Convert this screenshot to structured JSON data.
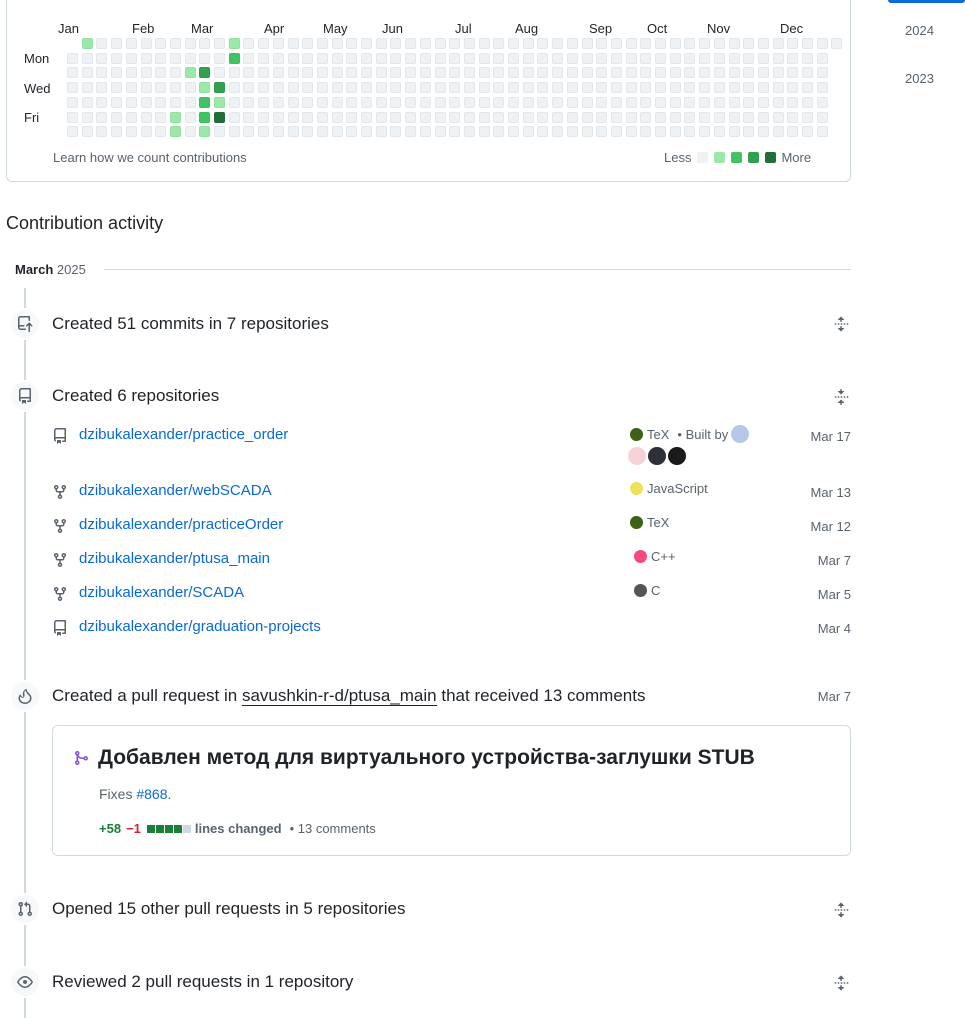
{
  "calendar": {
    "months": [
      "Jan",
      "Feb",
      "Mar",
      "Apr",
      "May",
      "Jun",
      "Jul",
      "Aug",
      "Sep",
      "Oct",
      "Nov",
      "Dec"
    ],
    "days": [
      "Mon",
      "Wed",
      "Fri"
    ],
    "learn_link": "Learn how we count contributions",
    "legend_less": "Less",
    "legend_more": "More",
    "level_colors": [
      "#eff2f5",
      "#9be9a8",
      "#40c463",
      "#30a14e",
      "#216e39"
    ],
    "active_cells": [
      {
        "week": 1,
        "day": 0,
        "level": 1
      },
      {
        "week": 7,
        "day": 5,
        "level": 1
      },
      {
        "week": 7,
        "day": 6,
        "level": 1
      },
      {
        "week": 8,
        "day": 2,
        "level": 1
      },
      {
        "week": 9,
        "day": 2,
        "level": 3
      },
      {
        "week": 9,
        "day": 3,
        "level": 1
      },
      {
        "week": 9,
        "day": 4,
        "level": 2
      },
      {
        "week": 9,
        "day": 5,
        "level": 2
      },
      {
        "week": 9,
        "day": 6,
        "level": 1
      },
      {
        "week": 10,
        "day": 3,
        "level": 3
      },
      {
        "week": 10,
        "day": 4,
        "level": 1
      },
      {
        "week": 10,
        "day": 5,
        "level": 4
      },
      {
        "week": 11,
        "day": 0,
        "level": 1
      },
      {
        "week": 11,
        "day": 1,
        "level": 2
      }
    ]
  },
  "years": [
    "2024",
    "2023"
  ],
  "activity": {
    "title": "Contribution activity",
    "month": "March",
    "year": "2025",
    "commits_summary": "Created 51 commits in 7 repositories",
    "repos_summary": "Created 6 repositories",
    "repos": [
      {
        "name": "dzibukalexander/practice_order",
        "icon": "repo-icon",
        "lang": "TeX",
        "lang_color": "#3d6117",
        "built_by": "Built by",
        "date": "Mar 17"
      },
      {
        "name": "dzibukalexander/webSCADA",
        "icon": "repo-forked-icon",
        "lang": "JavaScript",
        "lang_color": "#f1e05a",
        "date": "Mar 13"
      },
      {
        "name": "dzibukalexander/practiceOrder",
        "icon": "repo-forked-icon",
        "lang": "TeX",
        "lang_color": "#3d6117",
        "date": "Mar 12"
      },
      {
        "name": "dzibukalexander/ptusa_main",
        "icon": "repo-forked-icon",
        "lang": "C++",
        "lang_color": "#f34b7d",
        "date": "Mar 7"
      },
      {
        "name": "dzibukalexander/SCADA",
        "icon": "repo-forked-icon",
        "lang": "C",
        "lang_color": "#555555",
        "date": "Mar 5"
      },
      {
        "name": "dzibukalexander/graduation-projects",
        "icon": "repo-icon",
        "lang": "",
        "lang_color": "",
        "date": "Mar 4"
      }
    ],
    "pr_event": {
      "prefix": "Created a pull request in",
      "repo": "savushkin-r-d/ptusa_main",
      "suffix": "that received 13 comments",
      "date": "Mar 7",
      "card": {
        "title": "Добавлен метод для виртуального устройства-заглушки STUB",
        "body_prefix": "Fixes",
        "issue": "#868",
        "body_suffix": ".",
        "additions": "+58",
        "deletions": "−1",
        "lines_changed": "lines changed",
        "comments": "• 13 comments"
      }
    },
    "opened_summary": "Opened 15 other pull requests in 5 repositories",
    "reviewed_summary": "Reviewed 2 pull requests in 1 repository"
  }
}
